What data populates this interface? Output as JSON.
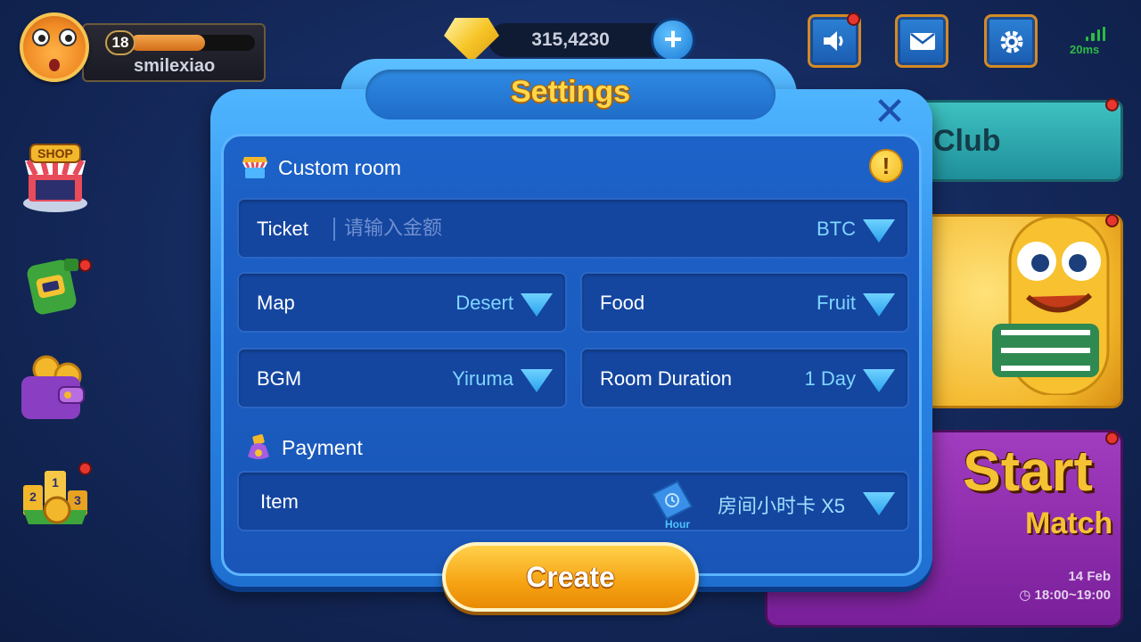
{
  "player": {
    "level": "18",
    "name": "smilexiao",
    "xp_progress": 0.6
  },
  "currency": {
    "gems": "315,4230",
    "add_label": "+"
  },
  "status": {
    "ping": "20ms"
  },
  "side_icons": [
    "shop-icon",
    "backpack-icon",
    "wallet-icon",
    "ranking-icon"
  ],
  "shop_label": "SHOP",
  "background_cards": {
    "club": "Club",
    "start_line1": "Start",
    "start_line2": "Match",
    "date": "14 Feb",
    "time": "18:00~19:00"
  },
  "dialog": {
    "title": "Settings",
    "close_label": "✕",
    "custom_room": {
      "heading": "Custom room",
      "ticket": {
        "label": "Ticket",
        "placeholder": "请输入金额",
        "value": "",
        "currency": "BTC"
      },
      "map": {
        "label": "Map",
        "value": "Desert"
      },
      "food": {
        "label": "Food",
        "value": "Fruit"
      },
      "bgm": {
        "label": "BGM",
        "value": "Yiruma"
      },
      "duration": {
        "label": "Room Duration",
        "value": "1 Day"
      }
    },
    "payment": {
      "heading": "Payment",
      "item": {
        "label": "Item",
        "icon_caption": "Hour",
        "value": "房间小时卡 X5"
      }
    },
    "create_label": "Create"
  },
  "colors": {
    "accent": "#2a86e6",
    "gold": "#ffd84a",
    "value_text": "#7fd6ff",
    "alert_red": "#e8362f"
  }
}
